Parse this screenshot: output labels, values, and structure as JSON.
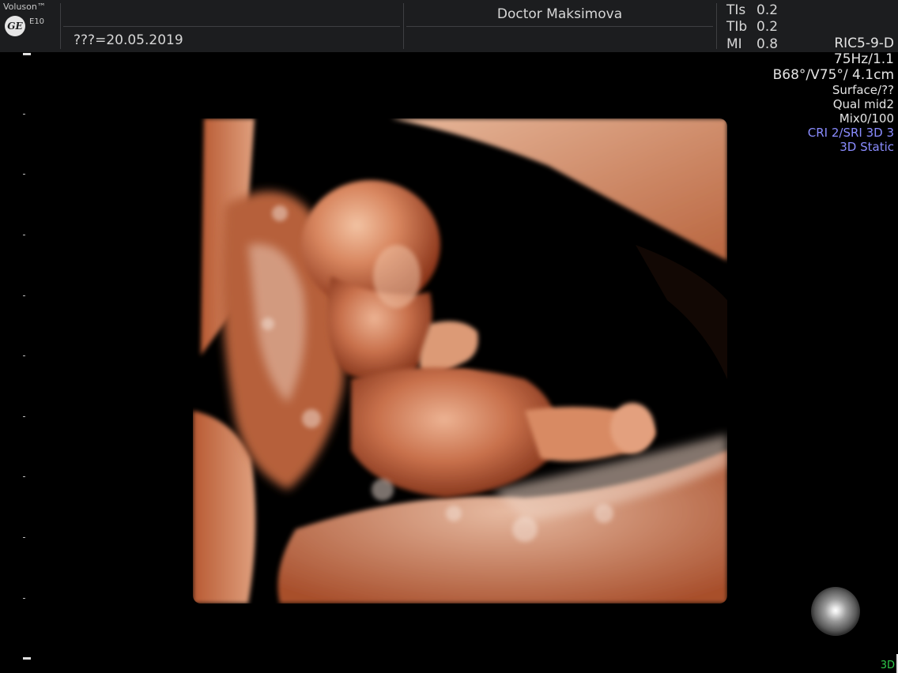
{
  "header": {
    "brand": "Voluson™",
    "logo_text": "GE",
    "model": "E10",
    "date_label": "???=20.05.2019",
    "doctor": "Doctor Maksimova",
    "indices": [
      {
        "label": "TIs",
        "value": "0.2"
      },
      {
        "label": "TIb",
        "value": "0.2"
      },
      {
        "label": "MI",
        "value": "0.8"
      }
    ]
  },
  "params": {
    "probe": "RIC5-9-D",
    "frequency": "75Hz/1.1",
    "angles": "B68°/V75°/ 4.1cm",
    "surface": "Surface/??",
    "quality": "Qual mid2",
    "mix": "Mix0/100",
    "cri_sri": "CRI 2/SRI 3D 3",
    "mode": "3D Static"
  },
  "status": {
    "mode_indicator": "3D"
  },
  "colors": {
    "header_bg": "#1c1d1f",
    "accent_blue": "#8a8cff",
    "mode_green": "#2fc94a",
    "tissue": "#c26a47"
  },
  "icons": {
    "logo": "ge-logo-icon",
    "light": "light-source-sphere-icon"
  }
}
